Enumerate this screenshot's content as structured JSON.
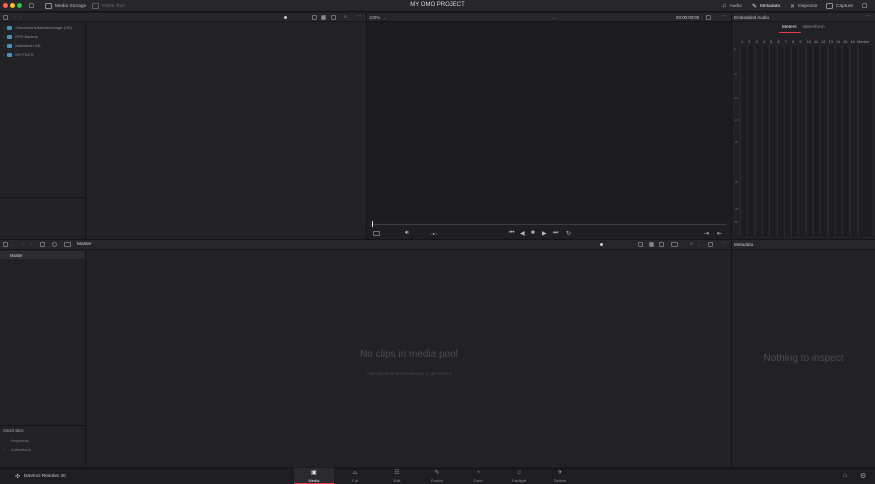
{
  "window": {
    "project_title": "MY OMO PROJECT",
    "traffic_colors": [
      "#ff5f57",
      "#febc2e",
      "#28c840"
    ]
  },
  "toolbar": {
    "media_storage": "Media Storage",
    "clone_tool": "Clone Tool",
    "audio": "Audio",
    "metadata": "Metadata",
    "inspector": "Inspector",
    "capture": "Capture"
  },
  "media_storage": {
    "locations": [
      "/Users/chris/Movies/Image (HD)",
      "EPX Backup",
      "Macintosh HD",
      "MY FILES"
    ]
  },
  "viewer": {
    "zoom": "100%",
    "timecode": "00:00:00:00"
  },
  "audio_panel": {
    "title": "Embedded Audio",
    "tab_meters": "Meters",
    "tab_waveform": "Waveform",
    "channels": [
      "1",
      "2",
      "3",
      "4",
      "5",
      "6",
      "7",
      "8",
      "9",
      "10",
      "11",
      "12",
      "13",
      "14",
      "15",
      "16"
    ],
    "monitor_label": "Monitor",
    "db_labels": [
      "0",
      "-5",
      "-10",
      "-15",
      "-20",
      "-30",
      "-40",
      "-50"
    ]
  },
  "media_pool": {
    "bin_title": "Master",
    "bins": [
      "Master"
    ],
    "smart_bins_title": "Smart Bins",
    "smart_bins": [
      "Keywords",
      "Collections"
    ],
    "empty_title": "No clips in media pool",
    "empty_hint": "Add clips from Media Storage to get started"
  },
  "metadata_panel": {
    "title": "Metadata",
    "empty_text": "Nothing to inspect"
  },
  "app": {
    "name": "DaVinci Resolve 20"
  },
  "pages": [
    {
      "label": "Media",
      "icon": "media-icon",
      "active": true
    },
    {
      "label": "Cut",
      "icon": "cut-icon",
      "active": false
    },
    {
      "label": "Edit",
      "icon": "edit-icon",
      "active": false
    },
    {
      "label": "Fusion",
      "icon": "fusion-icon",
      "active": false
    },
    {
      "label": "Color",
      "icon": "color-icon",
      "active": false
    },
    {
      "label": "Fairlight",
      "icon": "fairlight-icon",
      "active": false
    },
    {
      "label": "Deliver",
      "icon": "deliver-icon",
      "active": false
    }
  ],
  "accent_color": "#e23a4c"
}
